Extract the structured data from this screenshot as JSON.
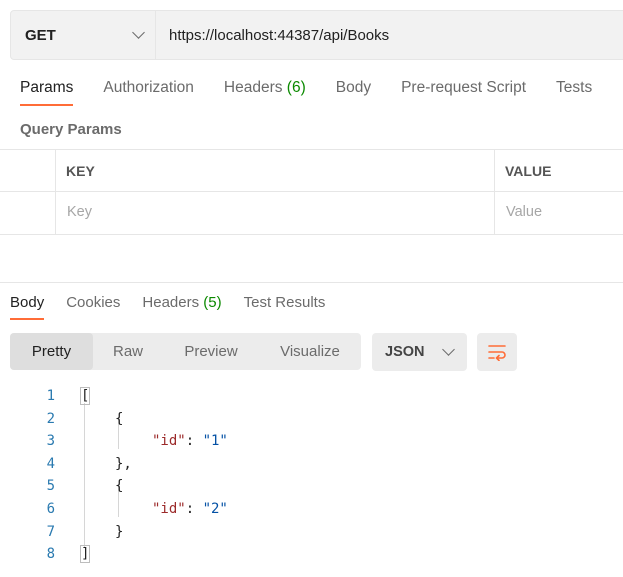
{
  "request": {
    "method": "GET",
    "url": "https://localhost:44387/api/Books"
  },
  "request_tabs": [
    {
      "label": "Params",
      "active": true
    },
    {
      "label": "Authorization"
    },
    {
      "label": "Headers",
      "count": "(6)"
    },
    {
      "label": "Body"
    },
    {
      "label": "Pre-request Script"
    },
    {
      "label": "Tests"
    }
  ],
  "query_params": {
    "title": "Query Params",
    "key_header": "KEY",
    "value_header": "VALUE",
    "key_placeholder": "Key",
    "value_placeholder": "Value"
  },
  "response_tabs": [
    {
      "label": "Body",
      "active": true
    },
    {
      "label": "Cookies"
    },
    {
      "label": "Headers",
      "count": "(5)"
    },
    {
      "label": "Test Results"
    }
  ],
  "view_modes": [
    "Pretty",
    "Raw",
    "Preview",
    "Visualize"
  ],
  "active_view": "Pretty",
  "format": "JSON",
  "icons": {
    "method_dropdown": "chevron-down-icon",
    "format_dropdown": "chevron-down-icon",
    "wrap": "wrap-lines-icon"
  },
  "colors": {
    "accent": "#ff6c37",
    "count": "#0b8a00",
    "json_key": "#9c2a2a",
    "json_string": "#0451a5",
    "line_number": "#2a7ab0"
  },
  "code": {
    "line_numbers": [
      "1",
      "2",
      "3",
      "4",
      "5",
      "6",
      "7",
      "8"
    ],
    "open_bracket": "[",
    "close_bracket": "]",
    "open_brace": "{",
    "close_brace_comma": "},",
    "close_brace": "}",
    "items": [
      {
        "key": "\"id\"",
        "value": "\"1\""
      },
      {
        "key": "\"id\"",
        "value": "\"2\""
      }
    ]
  }
}
